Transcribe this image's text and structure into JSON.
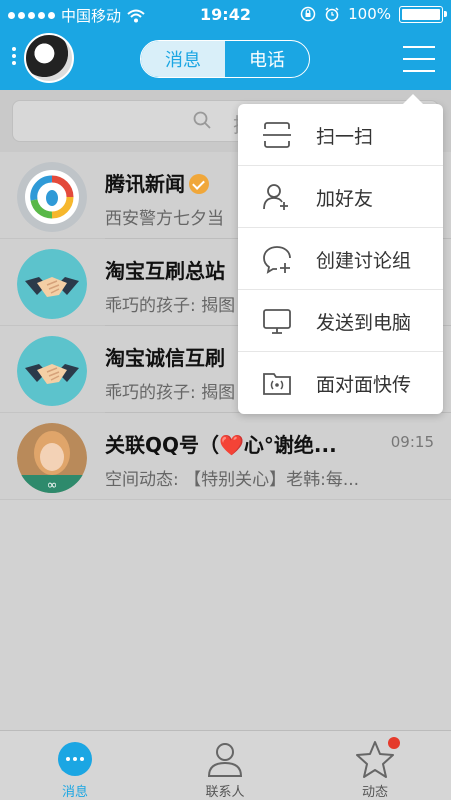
{
  "status_bar": {
    "carrier": "中国移动",
    "time": "19:42",
    "battery": "100%"
  },
  "header": {
    "tabs": [
      {
        "label": "消息",
        "active": true
      },
      {
        "label": "电话",
        "active": false
      }
    ]
  },
  "search": {
    "placeholder": "搜"
  },
  "conversations": [
    {
      "name": "腾讯新闻",
      "verified": true,
      "preview": "西安警方七夕当",
      "time": ""
    },
    {
      "name": "淘宝互刷总站",
      "verified": false,
      "preview": "乖巧的孩子: 揭图",
      "time": ""
    },
    {
      "name": "淘宝诚信互刷",
      "verified": false,
      "preview": "乖巧的孩子: 揭图",
      "time": ""
    },
    {
      "name": "关联QQ号（❤️心°谢绝...",
      "verified": false,
      "preview": "空间动态: 【特别关心】老韩:每...",
      "time": "09:15"
    }
  ],
  "dropdown_menu": {
    "items": [
      {
        "label": "扫一扫",
        "icon": "scan-icon"
      },
      {
        "label": "加好友",
        "icon": "add-friend-icon"
      },
      {
        "label": "创建讨论组",
        "icon": "create-group-icon"
      },
      {
        "label": "发送到电脑",
        "icon": "computer-icon"
      },
      {
        "label": "面对面快传",
        "icon": "face-transfer-icon"
      }
    ]
  },
  "tabbar": {
    "items": [
      {
        "label": "消息",
        "active": true
      },
      {
        "label": "联系人",
        "active": false
      },
      {
        "label": "动态",
        "active": false,
        "has_badge": true
      }
    ]
  },
  "colors": {
    "accent": "#1ba6e3",
    "badge": "#e53b2c",
    "verified": "#f0a73a"
  }
}
